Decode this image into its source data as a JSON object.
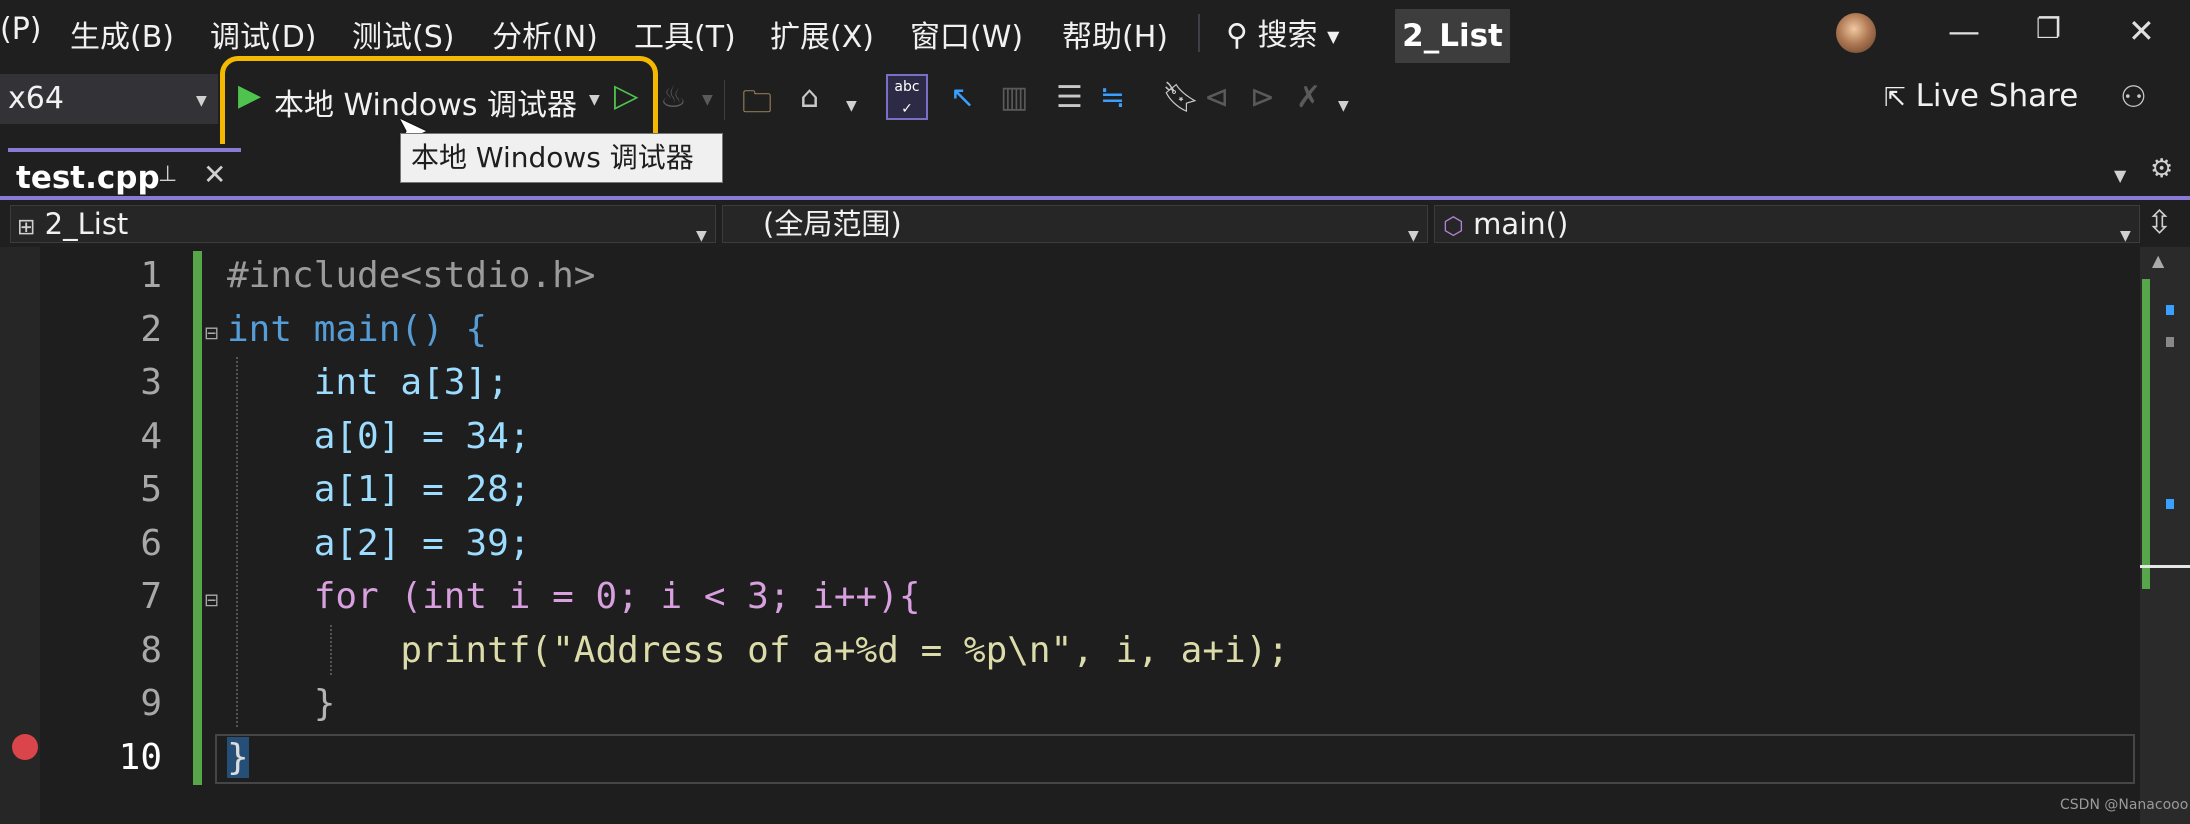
{
  "menu": [
    "(P)",
    "生成(B)",
    "调试(D)",
    "测试(S)",
    "分析(N)",
    "工具(T)",
    "扩展(X)",
    "窗口(W)",
    "帮助(H)"
  ],
  "search": {
    "label": "搜索"
  },
  "solution_badge": "2_List",
  "toolbar": {
    "platform": "x64",
    "run_label": "本地 Windows 调试器",
    "tooltip": "本地 Windows 调试器",
    "live_share": "Live Share"
  },
  "tab": {
    "title": "test.cpp"
  },
  "navbar": {
    "project": "2_List",
    "scope": "(全局范围)",
    "member": "main()"
  },
  "code": {
    "line_numbers": [
      "1",
      "2",
      "3",
      "4",
      "5",
      "6",
      "7",
      "8",
      "9",
      "10"
    ],
    "lines": [
      "#include<stdio.h>",
      "int main() {",
      "    int a[3];",
      "    a[0] = 34;",
      "    a[1] = 28;",
      "    a[2] = 39;",
      "    for (int i = 0; i < 3; i++){",
      "        printf(\"Address of a+%d = %p\\n\", i, a+i);",
      "    }",
      "}"
    ]
  },
  "watermark": "CSDN @Nanacooo",
  "colors": {
    "accent": "#8a7ad6",
    "highlight": "#f5b800",
    "keyword": "#569cd6",
    "string": "#d69d85",
    "breakpoint": "#d9454a"
  }
}
